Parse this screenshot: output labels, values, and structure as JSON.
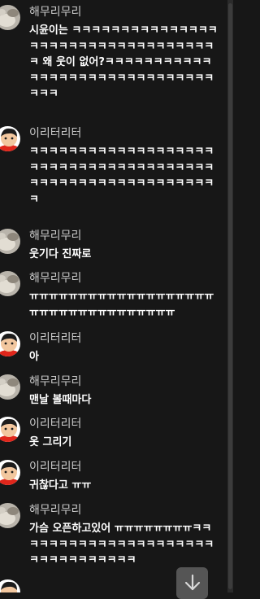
{
  "messages": [
    {
      "avatar": "cat-photo",
      "name": "해무리무리",
      "text": "시윤이는 ㅋㅋㅋㅋㅋㅋㅋㅋㅋㅋㅋㅋㅋㅋㅋㅋㅋㅋㅋㅋㅋㅋㅋㅋㅋㅋㅋㅋㅋㅋㅋㅋㅋㅋㅋ 왜 웃이 없어?ㅋㅋㅋㅋㅋㅋㅋㅋㅋㅋㅋㅋㅋㅋㅋㅋㅋㅋㅋㅋㅋㅋㅋㅋㅋㅋㅋㅋㅋㅋㅋㅋㅋ"
    },
    {
      "avatar": "cartoon-boy",
      "name": "이리터리터",
      "text": "ㅋㅋㅋㅋㅋㅋㅋㅋㅋㅋㅋㅋㅋㅋㅋㅋㅋㅋㅋㅋㅋㅋㅋㅋㅋㅋㅋㅋㅋㅋㅋㅋㅋㅋㅋㅋㅋㅋㅋㅋㅋㅋㅋㅋㅋㅋㅋㅋㅋㅋㅋㅋㅋㅋㅋㅋㅋㅋ"
    },
    {
      "avatar": "cat-photo",
      "name": "해무리무리",
      "text": "웃기다 진짜로"
    },
    {
      "avatar": "cat-photo",
      "name": "해무리무리",
      "text": "ㅠㅠㅠㅠㅠㅠㅠㅠㅠㅠㅠㅠㅠㅠㅠㅠㅠㅠㅠㅠㅠㅠㅠㅠㅠㅠㅠㅠㅠㅠㅠㅠㅠㅠ"
    },
    {
      "avatar": "cartoon-boy",
      "name": "이리터리터",
      "text": "아"
    },
    {
      "avatar": "cat-photo",
      "name": "해무리무리",
      "text": "맨날 볼때마다"
    },
    {
      "avatar": "cartoon-boy",
      "name": "이리터리터",
      "text": "옷 그리기"
    },
    {
      "avatar": "cartoon-boy",
      "name": "이리터리터",
      "text": "귀찮다고 ㅠㅠ"
    },
    {
      "avatar": "cat-photo",
      "name": "해무리무리",
      "text": "가슴 오픈하고있어 ㅠㅠㅠㅠㅠㅠㅠㅠㅋㅋㅋㅋㅋㅋㅋㅋㅋㅋㅋㅋㅋㅋㅋㅋㅋㅋㅋㅋㅋㅋㅋㅋㅋㅋㅋㅋㅋㅋㅋㅋ"
    }
  ],
  "scroll_button": {
    "icon": "arrow-down-icon"
  },
  "colors": {
    "background": "#171717",
    "name": "#c9c9c9",
    "text": "#ffffff",
    "fab": "#555555"
  }
}
